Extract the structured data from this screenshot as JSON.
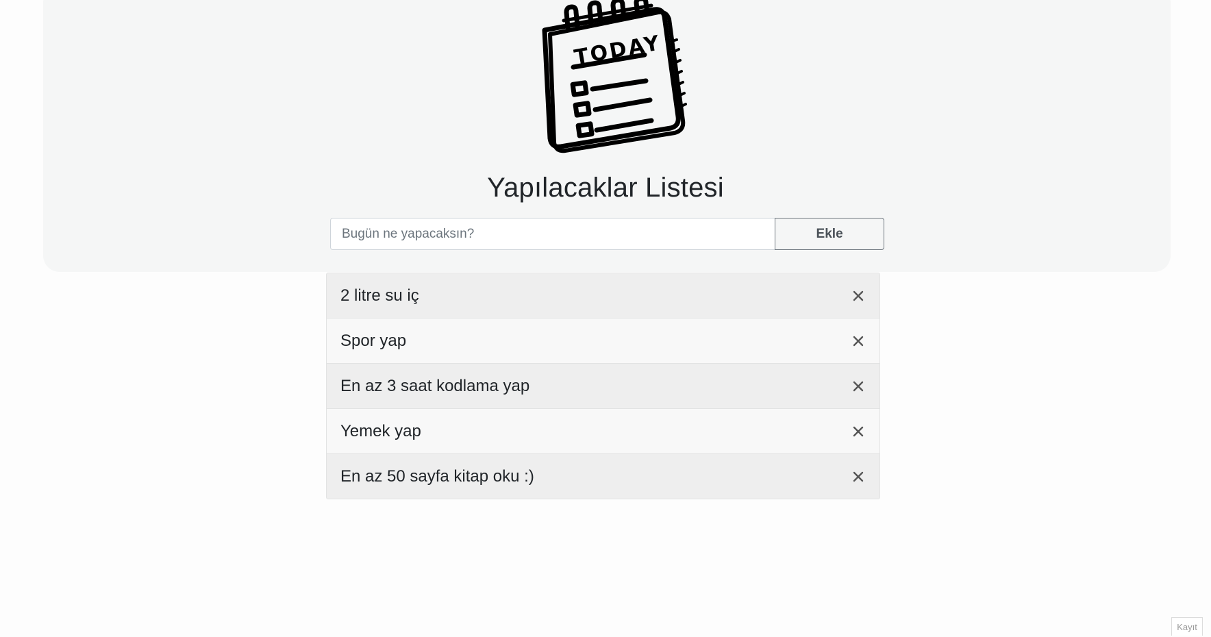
{
  "header": {
    "logo_text": "TODAY",
    "title": "Yapılacaklar Listesi"
  },
  "form": {
    "input_placeholder": "Bugün ne yapacaksın?",
    "input_value": "",
    "add_label": "Ekle"
  },
  "tasks": [
    {
      "text": "2 litre su iç"
    },
    {
      "text": "Spor yap"
    },
    {
      "text": "En az 3 saat kodlama yap"
    },
    {
      "text": "Yemek yap"
    },
    {
      "text": "En az 50 sayfa kitap oku :)"
    }
  ],
  "icons": {
    "logo": "notepad-icon",
    "delete": "close-icon"
  },
  "footer": {
    "badge": "Kayıt"
  },
  "colors": {
    "hero_bg": "#f5f6f6",
    "row_odd": "#eeeeee",
    "row_even": "#f8f8f8"
  }
}
